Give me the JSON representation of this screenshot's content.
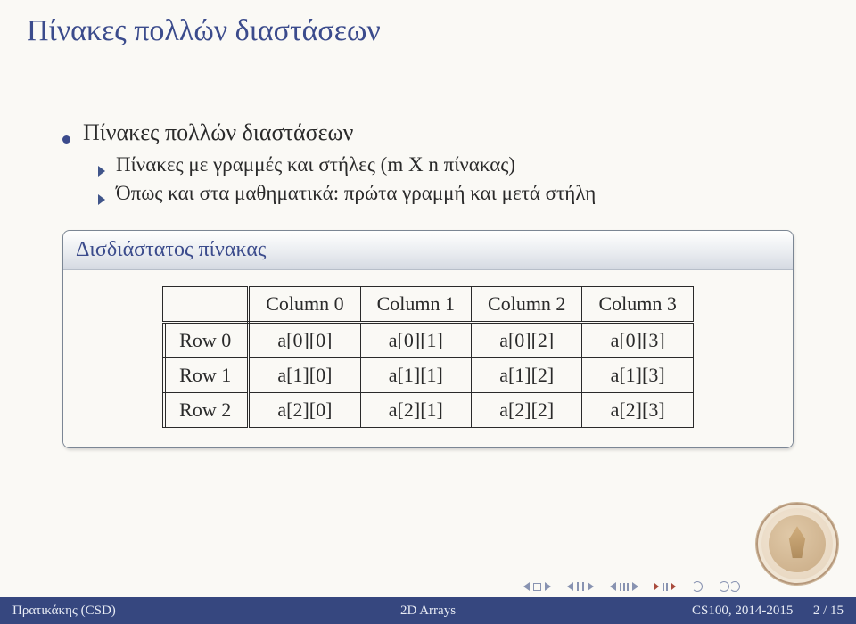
{
  "title": "Πίνακες πολλών διαστάσεων",
  "bullets": {
    "l1": "Πίνακες πολλών διαστάσεων",
    "l2a": "Πίνακες με γραμμές και στήλες (m X n πίνακας)",
    "l2b": "Όπως και στα μαθηματικά: πρώτα γραμμή και μετά στήλη"
  },
  "box_title": "Δισδιάστατος πίνακας",
  "table": {
    "col_headers": [
      "Column 0",
      "Column 1",
      "Column 2",
      "Column 3"
    ],
    "rows": [
      {
        "head": "Row 0",
        "cells": [
          "a[0][0]",
          "a[0][1]",
          "a[0][2]",
          "a[0][3]"
        ]
      },
      {
        "head": "Row 1",
        "cells": [
          "a[1][0]",
          "a[1][1]",
          "a[1][2]",
          "a[1][3]"
        ]
      },
      {
        "head": "Row 2",
        "cells": [
          "a[2][0]",
          "a[2][1]",
          "a[2][2]",
          "a[2][3]"
        ]
      }
    ]
  },
  "footer": {
    "left": "Πρατικάκης (CSD)",
    "center": "2D Arrays",
    "right": "CS100, 2014-2015",
    "page": "2 / 15"
  }
}
